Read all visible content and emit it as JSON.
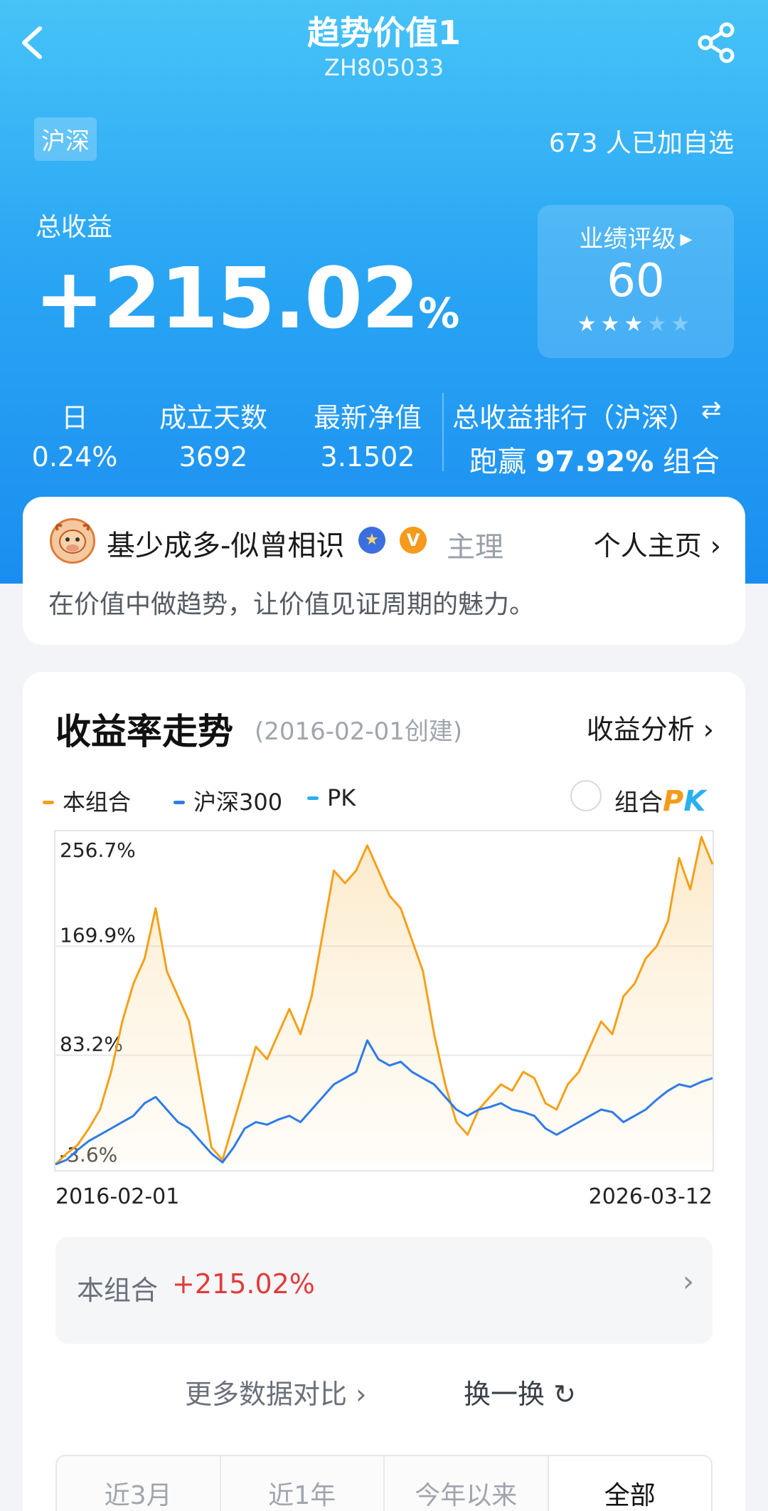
{
  "header": {
    "title": "趋势价值1",
    "code": "ZH805033"
  },
  "summary": {
    "market_tag": "沪深",
    "followers": "673 人已加自选",
    "total_label": "总收益",
    "total_value": "+215.02",
    "total_unit": "%",
    "rating_label": "业绩评级",
    "rating_score": "60",
    "rating_stars": 3,
    "rating_stars_max": 5
  },
  "stats": [
    {
      "label": "日",
      "value": "0.24%"
    },
    {
      "label": "成立天数",
      "value": "3692"
    },
    {
      "label": "最新净值",
      "value": "3.1502"
    }
  ],
  "rank": {
    "label": "总收益排行（沪深）",
    "prefix": "跑赢",
    "value": "97.92%",
    "suffix": "组合"
  },
  "manager": {
    "name": "基少成多-似曾相识",
    "role": "主理",
    "homepage_label": "个人主页",
    "description": "在价值中做趋势，让价值见证周期的魅力。",
    "badge_v": "V"
  },
  "chart_section": {
    "title": "收益率走势",
    "created": "(2016-02-01创建)",
    "analysis_link": "收益分析",
    "pk_label": "组合",
    "pk_word_p": "P",
    "pk_word_k": "K"
  },
  "chart_data": {
    "type": "line",
    "x_start": "2016-02-01",
    "x_end": "2026-03-12",
    "y_ticks": [
      "256.7%",
      "169.9%",
      "83.2%",
      "-3.6%"
    ],
    "y_tick_values": [
      256.7,
      169.9,
      83.2,
      -3.6
    ],
    "ylim": [
      -3.6,
      256.7
    ],
    "grid": true,
    "legend_position": "top-left",
    "series": [
      {
        "name": "本组合",
        "color": "#f5a01a",
        "values": [
          -3.6,
          5,
          12,
          25,
          40,
          70,
          110,
          140,
          160,
          200,
          150,
          130,
          110,
          60,
          10,
          0,
          30,
          60,
          90,
          80,
          100,
          120,
          100,
          130,
          180,
          230,
          220,
          230,
          250,
          230,
          210,
          200,
          175,
          150,
          100,
          60,
          30,
          20,
          40,
          50,
          60,
          55,
          70,
          65,
          45,
          40,
          60,
          70,
          90,
          110,
          100,
          130,
          140,
          160,
          170,
          190,
          240,
          215,
          256.7,
          235
        ]
      },
      {
        "name": "沪深300",
        "color": "#2f7be6",
        "values": [
          -3.6,
          0,
          8,
          15,
          20,
          25,
          30,
          35,
          45,
          50,
          40,
          30,
          25,
          15,
          5,
          -2,
          10,
          25,
          30,
          28,
          32,
          35,
          30,
          40,
          50,
          60,
          65,
          70,
          95,
          80,
          75,
          78,
          70,
          65,
          60,
          50,
          40,
          35,
          40,
          42,
          45,
          40,
          38,
          35,
          25,
          20,
          25,
          30,
          35,
          40,
          38,
          30,
          35,
          40,
          48,
          55,
          60,
          58,
          62,
          65
        ]
      },
      {
        "name": "PK",
        "color": "#28b0f0",
        "values": []
      }
    ]
  },
  "result": {
    "label": "本组合",
    "value": "+215.02%"
  },
  "actions": {
    "more_compare": "更多数据对比",
    "swap": "换一换"
  },
  "ranges": [
    "近3月",
    "近1年",
    "今年以来",
    "全部"
  ],
  "active_range": "全部"
}
